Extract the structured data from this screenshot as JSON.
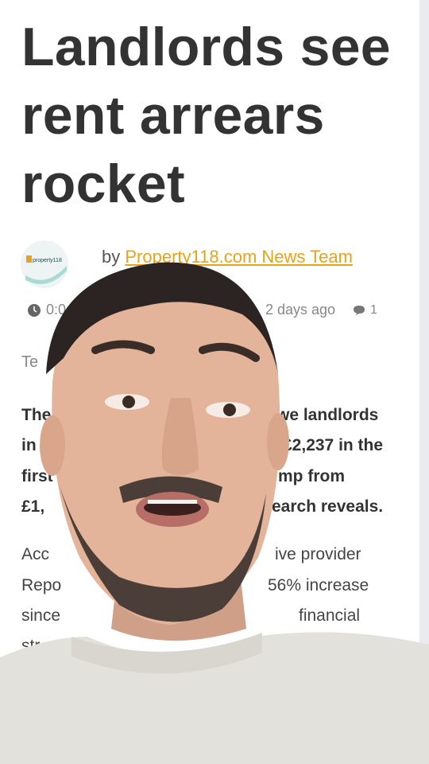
{
  "article": {
    "headline": "Landlords see rent arrears rocket",
    "logo_text": "property118",
    "byline_prefix": "by",
    "byline_author": "Property118.com News Team",
    "meta_time": "0:0",
    "meta_date": "2 days ago",
    "comment_count": "1",
    "tag_fragment": "Te",
    "bold_paragraph": {
      "left_fragments": [
        "The",
        "in u",
        "first",
        "£1,"
      ],
      "right_fragments": [
        "we landlords",
        "£2,237 in the",
        "mp from",
        "earch reveals."
      ]
    },
    "plain_paragraph": {
      "left_fragments": [
        "Acc",
        "Repo",
        "since",
        "str"
      ],
      "right_fragments": [
        "ive provider",
        "56% increase",
        "financial",
        ""
      ]
    }
  },
  "colors": {
    "text": "#333333",
    "accent": "#e8a317",
    "muted": "#888888",
    "skin": "#e3b49a",
    "shirt": "#e3e1db"
  },
  "icons": {
    "time": "clock-icon",
    "comments": "comment-icon"
  }
}
